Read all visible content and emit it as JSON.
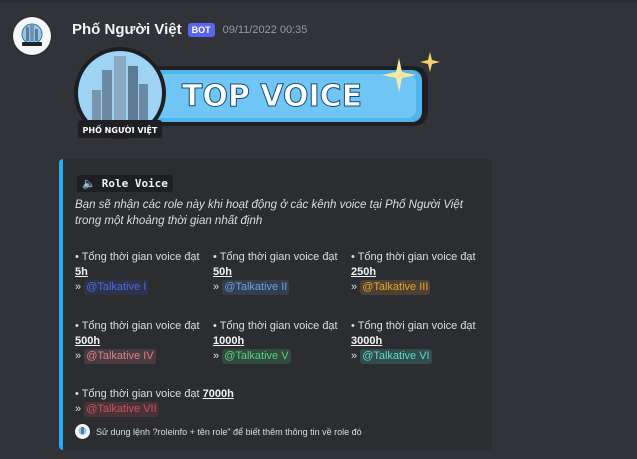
{
  "message": {
    "author": "Phố Người Việt",
    "bot_badge": "BOT",
    "timestamp": "09/11/2022 00:35"
  },
  "banner": {
    "logo_text": "PHỐ NGƯỜI VIỆT",
    "title": "TOP VOICE"
  },
  "embed": {
    "accent_color": "#21b0f3",
    "title_icon": "speaker-icon",
    "title": "Role Voice",
    "description": "Bạn sẽ nhận các role này khi hoạt động ở các kênh voice tại Phố Người Việt trong một khoảng thời gian nhất định",
    "fields": [
      {
        "prefix": "• Tổng thời gian voice đạt",
        "hours": "5h",
        "role": "@Talkative I",
        "role_color": "#3b55c6"
      },
      {
        "prefix": "• Tổng thời gian voice đạt",
        "hours": "50h",
        "role": "@Talkative II",
        "role_color": "#5b8fd4"
      },
      {
        "prefix": "• Tổng thời gian voice đạt",
        "hours": "250h",
        "role": "@Talkative III",
        "role_color": "#e8a235"
      },
      {
        "prefix": "• Tổng thời gian voice đạt",
        "hours": "500h",
        "role": "@Talkative IV",
        "role_color": "#d9828b"
      },
      {
        "prefix": "• Tổng thời gian voice đạt",
        "hours": "1000h",
        "role": "@Talkative V",
        "role_color": "#57d17b"
      },
      {
        "prefix": "• Tổng thời gian voice đạt",
        "hours": "3000h",
        "role": "@Talkative VI",
        "role_color": "#5fd8cf"
      },
      {
        "prefix": "• Tổng thời gian voice đạt",
        "hours": "7000h",
        "role": "@Talkative VII",
        "role_color": "#c9545a"
      }
    ],
    "arrow": "»",
    "footer": "Sử dụng lệnh ?roleinfo + tên role\" để biết thêm thông tin về role đó"
  }
}
